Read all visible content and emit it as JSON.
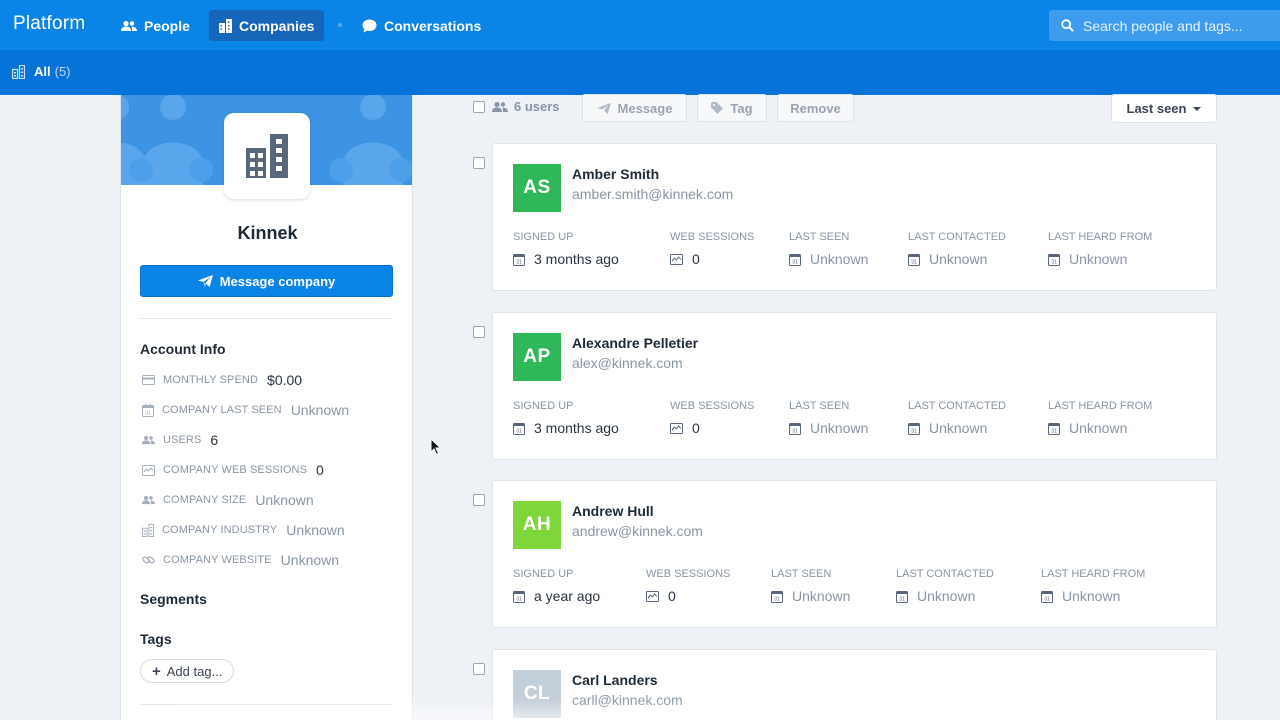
{
  "app": {
    "brand": "Platform",
    "nav": [
      {
        "label": "People",
        "icon": "people-icon",
        "active": false
      },
      {
        "label": "Companies",
        "icon": "building-icon",
        "active": true
      },
      {
        "label": "Conversations",
        "icon": "chat-bubble-icon",
        "active": false
      }
    ],
    "search": {
      "placeholder": "Search people and tags..."
    }
  },
  "subnav": {
    "label": "All",
    "count": "(5)"
  },
  "company": {
    "name": "Kinnek",
    "message_button": "Message company",
    "account_info_title": "Account Info",
    "info": [
      {
        "label": "Monthly spend",
        "value": "$0.00",
        "muted": false,
        "icon": "credit-card-icon"
      },
      {
        "label": "Company last seen",
        "value": "Unknown",
        "muted": true,
        "icon": "calendar-icon"
      },
      {
        "label": "Users",
        "value": "6",
        "muted": false,
        "icon": "people-icon"
      },
      {
        "label": "Company web sessions",
        "value": "0",
        "muted": false,
        "icon": "activity-icon"
      },
      {
        "label": "Company size",
        "value": "Unknown",
        "muted": true,
        "icon": "people-icon"
      },
      {
        "label": "Company industry",
        "value": "Unknown",
        "muted": true,
        "icon": "building-icon"
      },
      {
        "label": "Company website",
        "value": "Unknown",
        "muted": true,
        "icon": "link-icon"
      }
    ],
    "segments_title": "Segments",
    "tags_title": "Tags",
    "add_tag": "Add tag..."
  },
  "toolbar": {
    "users_count": "6 users",
    "message": "Message",
    "tag": "Tag",
    "remove": "Remove",
    "sort": "Last seen"
  },
  "stat_labels": {
    "signed_up": "Signed up",
    "web_sessions": "Web sessions",
    "last_seen": "Last seen",
    "last_contacted": "Last contacted",
    "last_heard_from": "Last heard from"
  },
  "users": [
    {
      "initials": "AS",
      "name": "Amber Smith",
      "email": "amber.smith@kinnek.com",
      "avatar_color": "#2fb85a",
      "signed_up": "3 months ago",
      "web_sessions": "0",
      "last_seen": "Unknown",
      "last_contacted": "Unknown",
      "last_heard_from": "Unknown"
    },
    {
      "initials": "AP",
      "name": "Alexandre Pelletier",
      "email": "alex@kinnek.com",
      "avatar_color": "#2fb85a",
      "signed_up": "3 months ago",
      "web_sessions": "0",
      "last_seen": "Unknown",
      "last_contacted": "Unknown",
      "last_heard_from": "Unknown"
    },
    {
      "initials": "AH",
      "name": "Andrew Hull",
      "email": "andrew@kinnek.com",
      "avatar_color": "#7ed63a",
      "signed_up": "a year ago",
      "web_sessions": "0",
      "last_seen": "Unknown",
      "last_contacted": "Unknown",
      "last_heard_from": "Unknown"
    },
    {
      "initials": "CL",
      "name": "Carl Landers",
      "email": "carll@kinnek.com",
      "avatar_color": "#c3cfd9"
    }
  ]
}
